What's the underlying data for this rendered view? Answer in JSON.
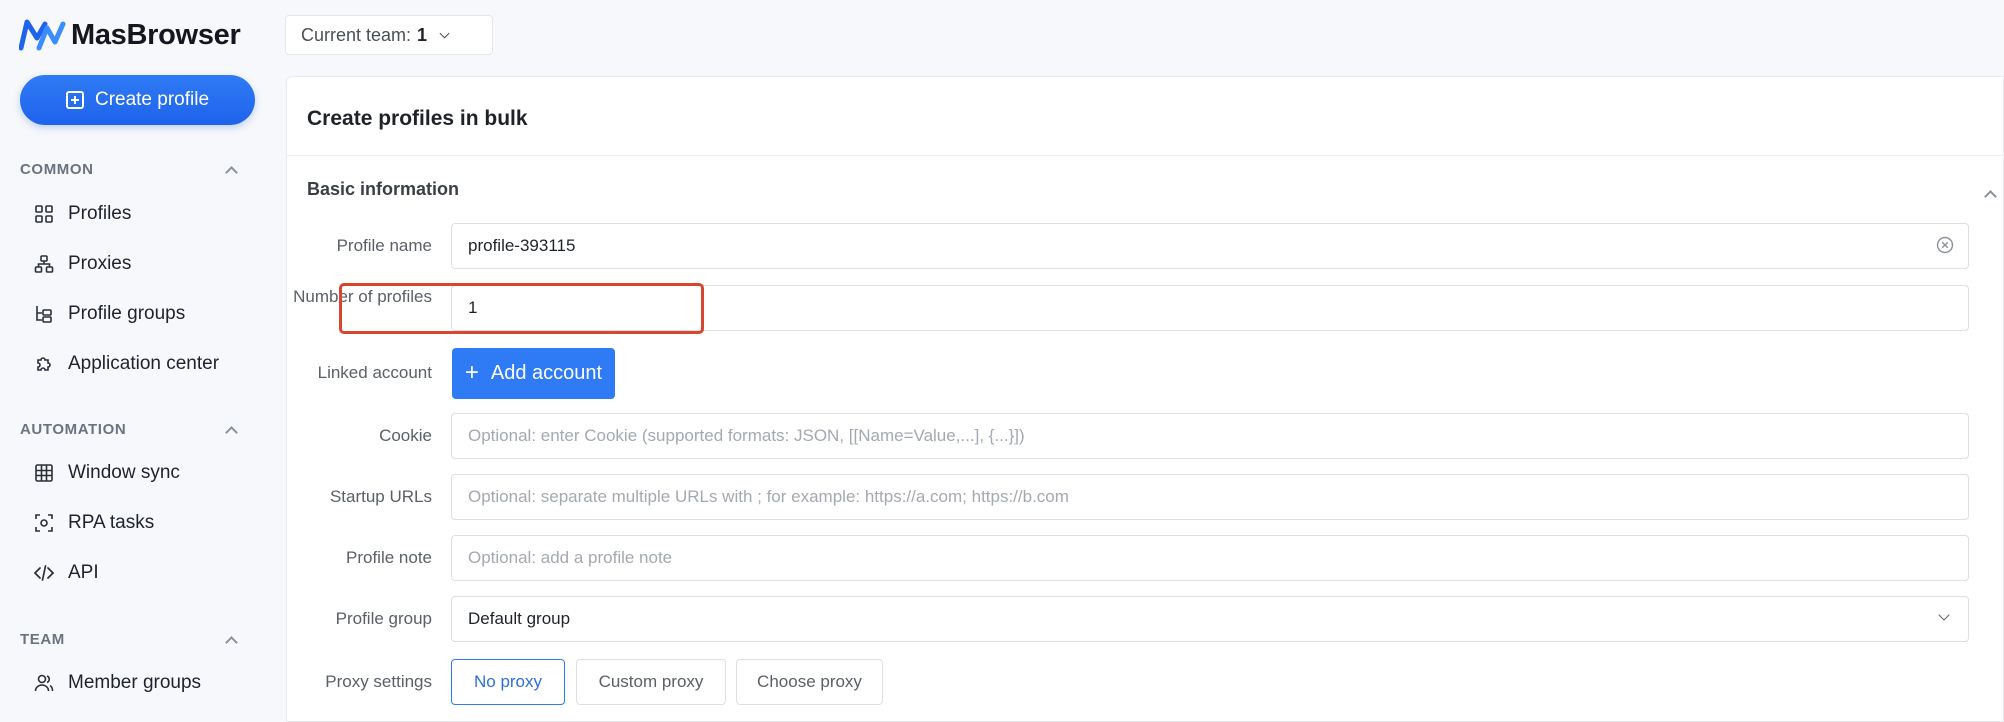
{
  "app": {
    "name": "MasBrowser"
  },
  "sidebar": {
    "create_label": "Create profile",
    "sections": [
      {
        "title": "COMMON",
        "items": [
          {
            "label": "Profiles",
            "icon": "grid-icon"
          },
          {
            "label": "Proxies",
            "icon": "network-icon"
          },
          {
            "label": "Profile groups",
            "icon": "tree-icon"
          },
          {
            "label": "Application center",
            "icon": "puzzle-icon"
          }
        ]
      },
      {
        "title": "AUTOMATION",
        "items": [
          {
            "label": "Window sync",
            "icon": "table-icon"
          },
          {
            "label": "RPA tasks",
            "icon": "scan-icon"
          },
          {
            "label": "API",
            "icon": "code-icon"
          }
        ]
      },
      {
        "title": "TEAM",
        "items": [
          {
            "label": "Member groups",
            "icon": "users-icon"
          }
        ]
      }
    ]
  },
  "header": {
    "team_label": "Current team:",
    "team_value": "1"
  },
  "panel": {
    "title": "Create profiles in bulk",
    "section_title": "Basic information",
    "fields": {
      "profile_name": {
        "label": "Profile name",
        "value": "profile-393115"
      },
      "number_of_profiles": {
        "label": "Number of profiles",
        "value": "1"
      },
      "linked_account": {
        "label": "Linked account",
        "button": "Add account"
      },
      "cookie": {
        "label": "Cookie",
        "placeholder": "Optional: enter Cookie (supported formats: JSON, [[Name=Value,...], {...}])"
      },
      "startup_urls": {
        "label": "Startup URLs",
        "placeholder": "Optional: separate multiple URLs with ; for example: https://a.com; https://b.com"
      },
      "profile_note": {
        "label": "Profile note",
        "placeholder": "Optional: add a profile note"
      },
      "profile_group": {
        "label": "Profile group",
        "value": "Default group"
      },
      "proxy_settings": {
        "label": "Proxy settings",
        "options": [
          "No proxy",
          "Custom proxy",
          "Choose proxy"
        ],
        "selected": "No proxy"
      }
    }
  },
  "colors": {
    "accent": "#2f7bf5",
    "highlight": "#d9462f"
  }
}
